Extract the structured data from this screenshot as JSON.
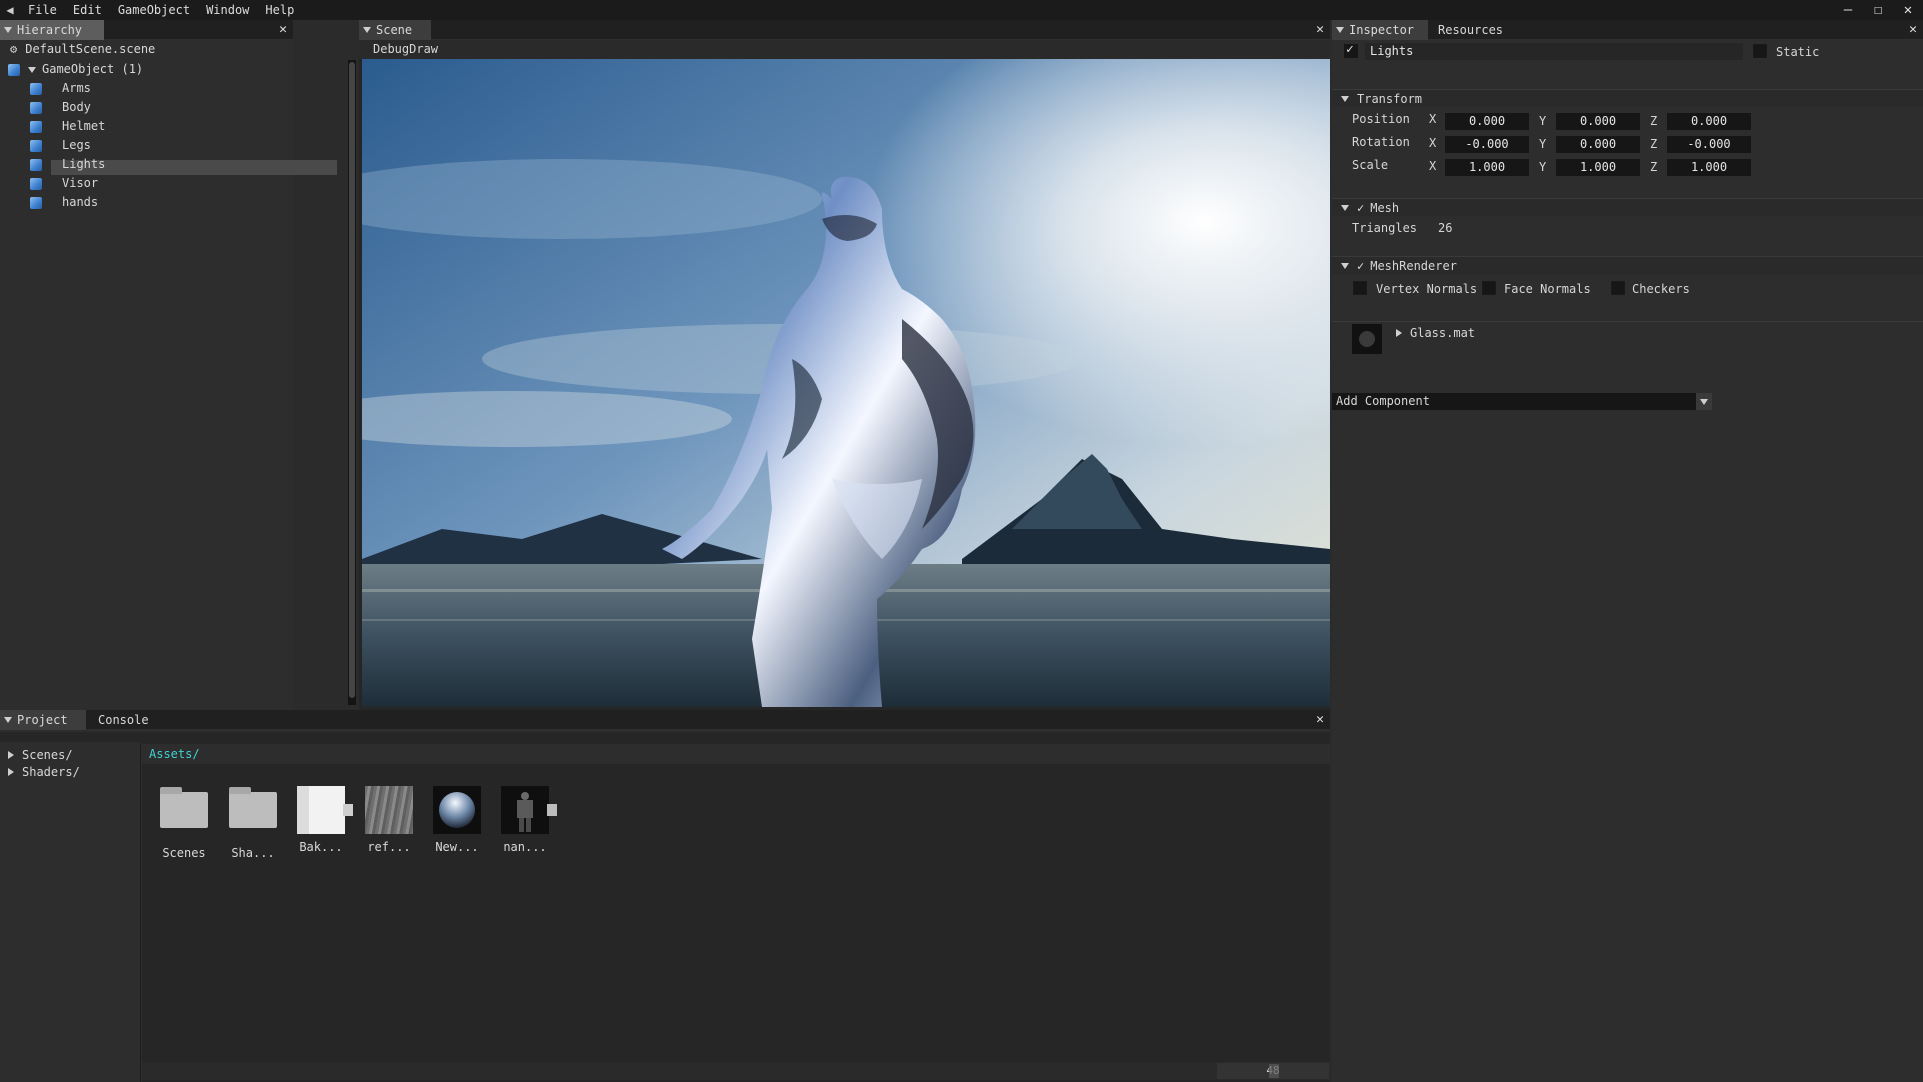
{
  "menubar": {
    "items": [
      "File",
      "Edit",
      "GameObject",
      "Window",
      "Help"
    ],
    "window_buttons": [
      "minimize-icon",
      "maximize-icon",
      "close-icon"
    ]
  },
  "hierarchy": {
    "tab": "Hierarchy",
    "scene_file": "DefaultScene.scene",
    "root": "GameObject (1)",
    "children": [
      "Arms",
      "Body",
      "Helmet",
      "Legs",
      "Lights",
      "Visor",
      "hands"
    ],
    "selected": "Lights"
  },
  "scene": {
    "tab": "Scene",
    "toolbar_label": "DebugDraw"
  },
  "inspector": {
    "tabs": [
      "Inspector",
      "Resources"
    ],
    "object_name": "Lights",
    "static_label": "Static",
    "transform": {
      "title": "Transform",
      "rows": [
        {
          "label": "Position",
          "x": "0.000",
          "y": "0.000",
          "z": "0.000"
        },
        {
          "label": "Rotation",
          "x": "-0.000",
          "y": "0.000",
          "z": "-0.000"
        },
        {
          "label": "Scale",
          "x": "1.000",
          "y": "1.000",
          "z": "1.000"
        }
      ],
      "axis_labels": [
        "X",
        "Y",
        "Z"
      ]
    },
    "mesh": {
      "title": "Mesh",
      "triangles_label": "Triangles",
      "triangles_value": "26"
    },
    "mesh_renderer": {
      "title": "MeshRenderer",
      "options": [
        "Vertex Normals",
        "Face Normals",
        "Checkers"
      ],
      "material": "Glass.mat"
    },
    "add_component": "Add Component"
  },
  "project": {
    "tabs": [
      "Project",
      "Console"
    ],
    "tree": [
      "Scenes/",
      "Shaders/"
    ],
    "path": "Assets/",
    "assets": [
      {
        "name": "Scenes",
        "kind": "folder"
      },
      {
        "name": "Sha...",
        "kind": "folder"
      },
      {
        "name": "Bak...",
        "kind": "texture-white"
      },
      {
        "name": "ref...",
        "kind": "texture-gray"
      },
      {
        "name": "New...",
        "kind": "material-sphere"
      },
      {
        "name": "nan...",
        "kind": "model"
      }
    ],
    "zoom_value": "48"
  },
  "colors": {
    "accent_path": "#3fd3d3",
    "selection": "#4a4a4a",
    "tab_selected": "#5d5d5d",
    "field_bg": "#161616",
    "panel_bg": "#2d2d2d"
  }
}
